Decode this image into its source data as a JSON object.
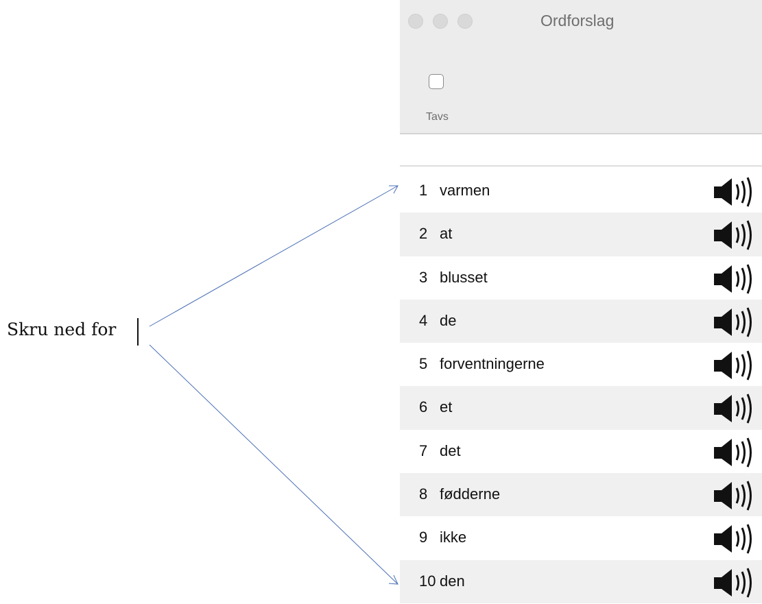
{
  "document": {
    "text": "Skru ned for"
  },
  "window": {
    "title": "Ordforslag",
    "toolbar": {
      "silent_label": "Tavs",
      "silent_checked": false
    }
  },
  "suggestions": [
    {
      "number": "1",
      "word": "varmen"
    },
    {
      "number": "2",
      "word": "at"
    },
    {
      "number": "3",
      "word": "blusset"
    },
    {
      "number": "4",
      "word": "de"
    },
    {
      "number": "5",
      "word": "forventningerne"
    },
    {
      "number": "6",
      "word": "et"
    },
    {
      "number": "7",
      "word": "det"
    },
    {
      "number": "8",
      "word": "fødderne"
    },
    {
      "number": "9",
      "word": "ikke"
    },
    {
      "number": "10",
      "word": "den"
    }
  ],
  "icons": {
    "speaker": "speaker-icon",
    "arrow_color": "#4a6fb5"
  }
}
